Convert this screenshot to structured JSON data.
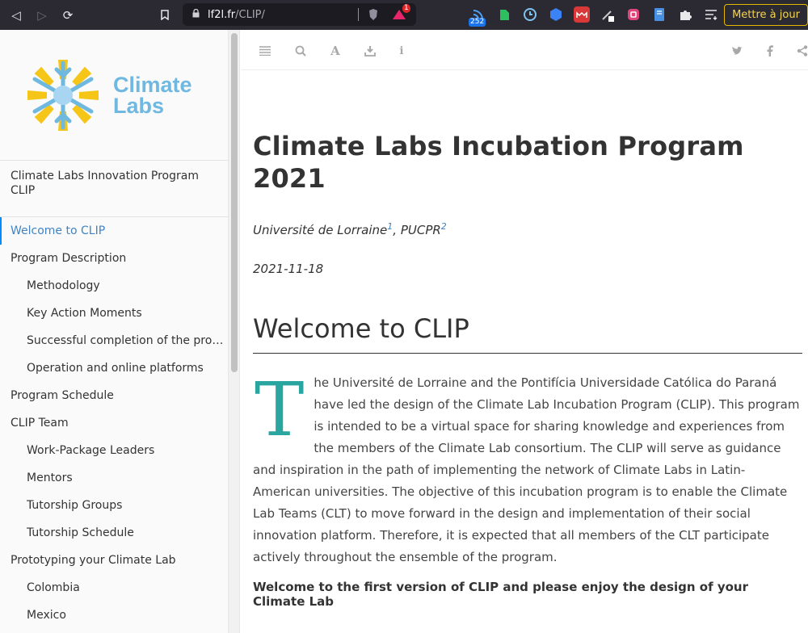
{
  "browser": {
    "url_host": "lf2l.fr",
    "url_path": "/CLIP/",
    "rss_badge": "252",
    "brave_badge": "1",
    "update_label": "Mettre à jour"
  },
  "sidebar": {
    "logo_line1": "Climate",
    "logo_line2": "Labs",
    "book_title": "Climate Labs Innovation Program CLIP",
    "items": [
      {
        "label": "Welcome to CLIP"
      },
      {
        "label": "Program Description"
      },
      {
        "label": "Methodology"
      },
      {
        "label": "Key Action Moments"
      },
      {
        "label": "Successful completion of the prog..."
      },
      {
        "label": "Operation and online platforms"
      },
      {
        "label": "Program Schedule"
      },
      {
        "label": "CLIP Team"
      },
      {
        "label": "Work-Package Leaders"
      },
      {
        "label": "Mentors"
      },
      {
        "label": "Tutorship Groups"
      },
      {
        "label": "Tutorship Schedule"
      },
      {
        "label": "Prototyping your Climate Lab"
      },
      {
        "label": "Colombia"
      },
      {
        "label": "Mexico"
      }
    ]
  },
  "document": {
    "title": "Climate Labs Incubation Program 2021",
    "author1": "Université de Lorraine",
    "author1_sup": "1",
    "author_sep": ", ",
    "author2": "PUCPR",
    "author2_sup": "2",
    "date": "2021-11-18",
    "section_heading": "Welcome to CLIP",
    "dropcap": "T",
    "paragraph": "he Université de Lorraine and the Pontifícia Universidade Católica do Paraná have led the design of the Climate Lab Incubation Program (CLIP). This program is intended to be a virtual space for sharing knowledge and experiences from the members of the Climate Lab consortium. The CLIP will serve as guidance and inspiration in the path of implementing the network of Climate Labs in Latin-American universities. The objective of this incubation program is to enable the Climate Lab Teams (CLT) to move forward in the design and implementation of their social innovation platform. Therefore, it is expected that all members of the CLT participate actively throughout the ensemble of the program.",
    "closing": "Welcome to the first version of CLIP and please enjoy the design of your Climate Lab"
  }
}
